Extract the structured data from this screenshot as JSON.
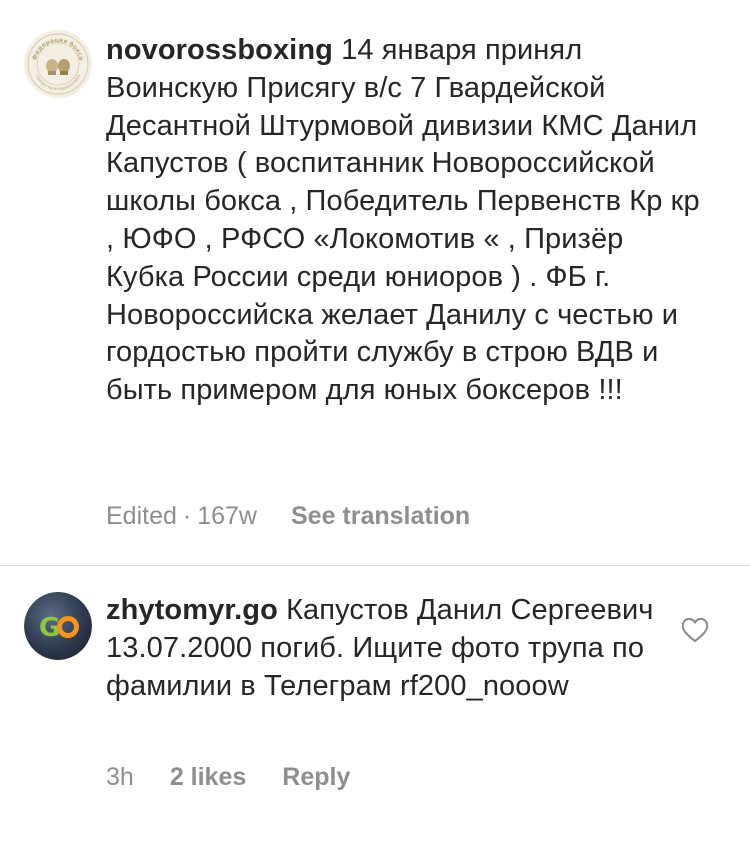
{
  "comments": [
    {
      "username": "novorossboxing",
      "text": " 14 января принял Воинскую Присягу в/с 7 Гвардейской Десантной Штурмовой дивизии КМС Данил Капустов ( воспитанник Новороссийской школы бокса , Победитель Первенств Кр кр , ЮФО , РФСО «Локомотив « , Призёр Кубка России среди юниоров ) . ФБ г. Новороссийска желает Данилу с честью и гордостью пройти службу в строю ВДВ и быть примером для юных боксеров !!!",
      "edited": "Edited",
      "separator": "·",
      "time": "167w",
      "see_translation": "See translation",
      "avatar_text_top": "Федерация бокса",
      "avatar_text_bottom": "города-героя Новороссийск"
    },
    {
      "username": "zhytomyr.go",
      "text": " Капустов Данил Сергеевич 13.07.2000 погиб. Ищите фото трупа по фамилии в Телеграм rf200_nooow",
      "time": "3h",
      "likes": "2 likes",
      "reply": "Reply",
      "avatar_text": "GO",
      "like_icon": "heart-outline-icon"
    }
  ],
  "colors": {
    "text": "#262626",
    "meta": "#8e8e8e",
    "divider": "#dbdbdb",
    "go_green": "#8dc63f",
    "go_orange": "#f7941d"
  }
}
